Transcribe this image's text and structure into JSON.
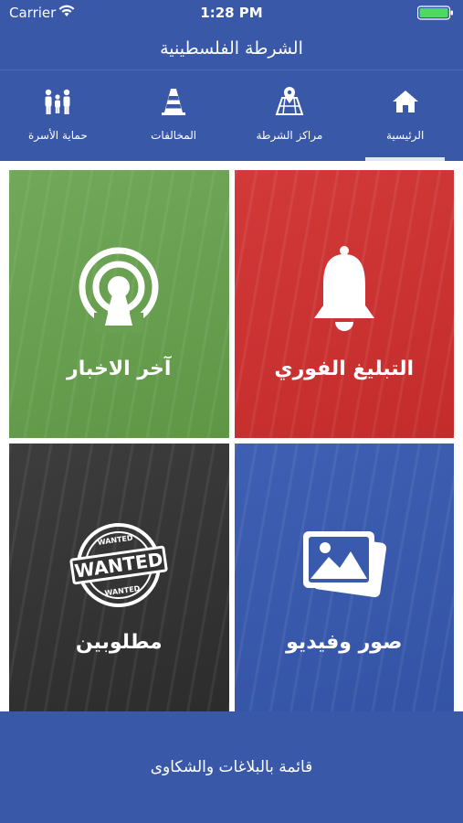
{
  "status_bar": {
    "carrier": "Carrier",
    "time": "1:28 PM"
  },
  "header": {
    "title": "الشرطة الفلسطينية"
  },
  "tabs": [
    {
      "label": "الرئيسية",
      "icon": "home-icon",
      "active": true
    },
    {
      "label": "مراكز الشرطة",
      "icon": "map-pin-icon",
      "active": false
    },
    {
      "label": "المخالفات",
      "icon": "traffic-cone-icon",
      "active": false
    },
    {
      "label": "حماية الأسرة",
      "icon": "family-icon",
      "active": false
    }
  ],
  "tiles": [
    {
      "label": "التبليغ الفوري",
      "icon": "bell-icon",
      "color": "#c93232"
    },
    {
      "label": "آخر الاخبار",
      "icon": "broadcast-icon",
      "color": "#6aa052"
    },
    {
      "label": "صور وفيديو",
      "icon": "gallery-icon",
      "color": "#3a5aad"
    },
    {
      "label": "مطلوبين",
      "icon": "wanted-stamp-icon",
      "color": "#333333"
    }
  ],
  "wanted_stamp": {
    "big": "WANTED",
    "small": "WANTED"
  },
  "footer": {
    "label": "قائمة بالبلاغات والشكاوى"
  },
  "colors": {
    "primary": "#3a58a8",
    "battery": "#4cd964"
  }
}
